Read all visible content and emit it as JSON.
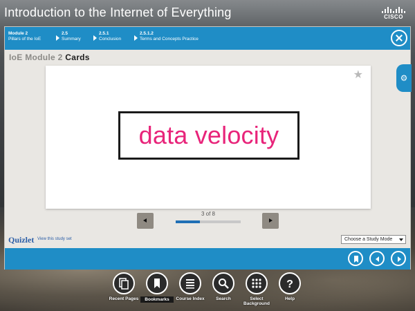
{
  "app": {
    "title": "Introduction to the Internet of Everything",
    "brand": "CISCO"
  },
  "breadcrumb": [
    {
      "num": "Module 2",
      "label": "Pillars of the IoE"
    },
    {
      "num": "2.5",
      "label": "Summary"
    },
    {
      "num": "2.5.1",
      "label": "Conclusion"
    },
    {
      "num": "2.5.1.2",
      "label": "Terms and Concepts Practice"
    }
  ],
  "section": {
    "module": "IoE Module 2",
    "kind": "Cards"
  },
  "card": {
    "term": "data velocity"
  },
  "pager": {
    "text": "3 of 8",
    "progress": 0.375
  },
  "quizlet": {
    "logo": "Quizlet",
    "link": "View this study set",
    "study_mode": "Choose a Study Mode"
  },
  "dock": [
    {
      "label": "Recent Pages",
      "icon": "pages-icon"
    },
    {
      "label": "Bookmarks",
      "icon": "bookmark-icon"
    },
    {
      "label": "Course Index",
      "icon": "index-icon"
    },
    {
      "label": "Search",
      "icon": "search-icon"
    },
    {
      "label": "Select Background",
      "icon": "grid-icon"
    },
    {
      "label": "Help",
      "icon": "help-icon"
    }
  ],
  "colors": {
    "accent": "#1f8dc6",
    "term": "#e8247a",
    "panel": "#e9e7e3"
  }
}
